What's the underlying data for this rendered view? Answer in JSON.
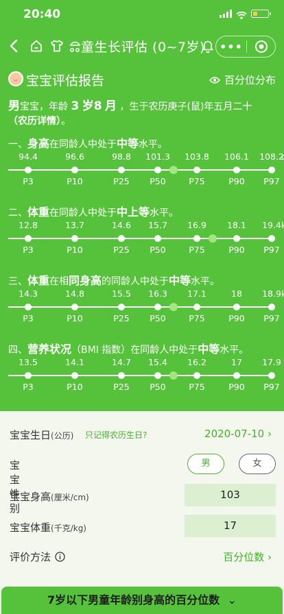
{
  "status": {
    "time": "20:40"
  },
  "nav": {
    "title": "童生长评估 (0~7岁)",
    "more_glyph": "•••"
  },
  "report": {
    "title": "宝宝评估报告",
    "percentile_link": "百分位分布"
  },
  "summary": {
    "gender": "男",
    "text1": "宝宝，年龄",
    "age_years": "3",
    "text2": "岁",
    "age_months": "8",
    "text3": "月",
    "text4": "，生于农历庚子(鼠)年五月二十",
    "lunar_link": "（农历详情）",
    "text5": "。"
  },
  "percentile_labels": [
    "P3",
    "P10",
    "P25",
    "P50",
    "P75",
    "P90",
    "P97"
  ],
  "sections": [
    {
      "prefix": "一、",
      "metric": "身高",
      "middle": "在同龄人中处于",
      "level": "中等",
      "suffix": "水平。",
      "values": [
        "94.4",
        "96.6",
        "98.8",
        "101.3",
        "103.8",
        "106.1",
        "108.2"
      ],
      "unit": "cm",
      "marker_percentile": 60
    },
    {
      "prefix": "二、",
      "metric": "体重",
      "middle": "在同龄人中处于",
      "level": "中上等",
      "suffix": "水平。",
      "values": [
        "12.8",
        "13.7",
        "14.6",
        "15.7",
        "16.9",
        "18.1",
        "19.4"
      ],
      "unit": "kg",
      "marker_percentile": 81
    },
    {
      "prefix": "三、",
      "metric": "体重",
      "middle": "在相",
      "middle_bold": "同身高",
      "middle2": "的同龄人中处于",
      "level": "中等",
      "suffix": "水平。",
      "values": [
        "14.3",
        "14.8",
        "15.5",
        "16.3",
        "17.1",
        "18",
        "18.9"
      ],
      "unit": "kg",
      "marker_percentile": 60
    },
    {
      "prefix": "四、",
      "metric": "营养状况",
      "middle": "（BMI 指数）在同龄人中处于",
      "level": "中等",
      "suffix": "水平。",
      "values": [
        "13.5",
        "14.1",
        "14.7",
        "15.4",
        "16.2",
        "17",
        "17.9"
      ],
      "unit": "",
      "marker_percentile": 60
    }
  ],
  "form": {
    "birthday_label": "宝宝生日",
    "birthday_sub": "(公历)",
    "birthday_hint": "只记得农历生日?",
    "birthday_value": "2020-07-10",
    "gender_label": "宝宝性别",
    "gender_male": "男",
    "gender_female": "女",
    "height_label": "宝宝身高",
    "height_unit": "(厘米/cm)",
    "height_value": "103",
    "weight_label": "宝宝体重",
    "weight_unit": "(千克/kg)",
    "weight_value": "17",
    "method_label": "评价方法",
    "method_value": "百分位数"
  },
  "bottom": {
    "title": "7岁以下男童年龄别身高的百分位数"
  },
  "colors": {
    "primary_green": "#56c23c",
    "accent_green": "#45b12a",
    "marker_green": "#a6e47d",
    "input_bg": "#dcefd0"
  }
}
